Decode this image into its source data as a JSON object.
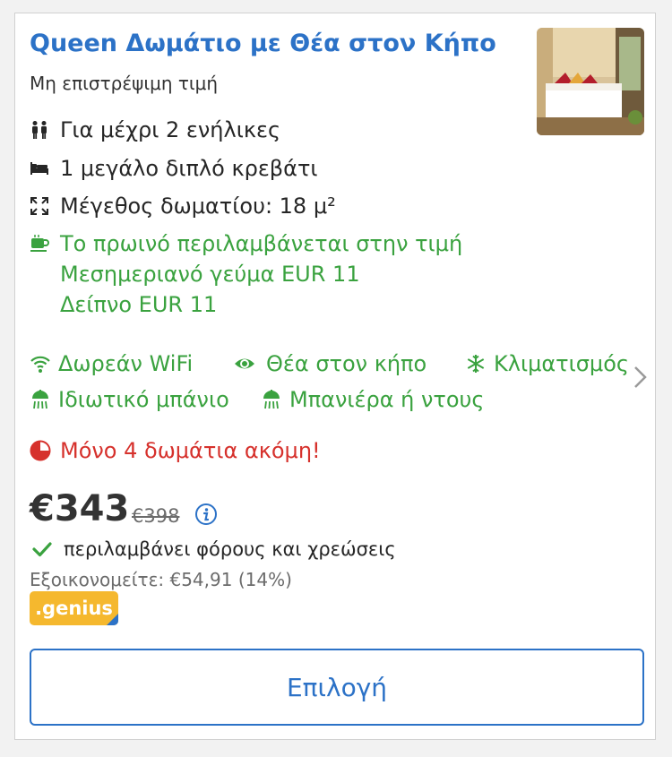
{
  "room": {
    "title": "Queen Δωμάτιο με Θέα στον Κήπο",
    "policy": "Μη επιστρέψιμη τιμή"
  },
  "details": {
    "guests": "Για μέχρι 2 ενήλικες",
    "bed": "1 μεγάλο διπλό κρεβάτι",
    "size": "Μέγεθος δωματίου: 18 μ²"
  },
  "meals": {
    "breakfast": "Το πρωινό περιλαμβάνεται στην τιμή",
    "lunch": "Μεσημεριανό γεύμα EUR 11",
    "dinner": "Δείπνο EUR 11"
  },
  "facilities": {
    "wifi": "Δωρεάν WiFi",
    "view": "Θέα στον κήπο",
    "ac": "Κλιματισμός",
    "bathroom": "Ιδιωτικό μπάνιο",
    "bath": "Μπανιέρα ή ντους"
  },
  "availability": {
    "message": "Μόνο 4 δωμάτια ακόμη!"
  },
  "pricing": {
    "price": "€343",
    "original": "€398",
    "taxes": "περιλαμβάνει φόρους και χρεώσεις",
    "saving": "Εξοικονομείτε: €54,91 (14%)",
    "badge": ".genius"
  },
  "actions": {
    "select": "Επιλογή"
  },
  "colors": {
    "link_blue": "#2c72c7",
    "green": "#3aa23f",
    "red": "#d6312c",
    "genius_yellow": "#f5b82e"
  }
}
